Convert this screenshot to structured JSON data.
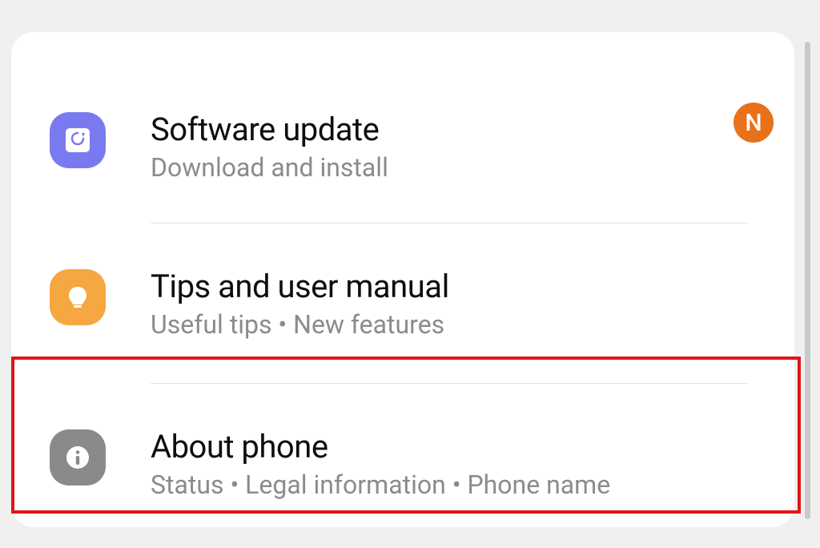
{
  "badge": {
    "letter": "N"
  },
  "items": [
    {
      "title": "Software update",
      "subtitle": "Download and install",
      "icon": "update-icon",
      "icon_color": "purple"
    },
    {
      "title": "Tips and user manual",
      "subtitle": "Useful tips  •  New features",
      "icon": "lightbulb-icon",
      "icon_color": "orange"
    },
    {
      "title": "About phone",
      "subtitle": "Status  •  Legal information  •  Phone name",
      "icon": "info-icon",
      "icon_color": "gray"
    }
  ],
  "highlighted_index": 2
}
